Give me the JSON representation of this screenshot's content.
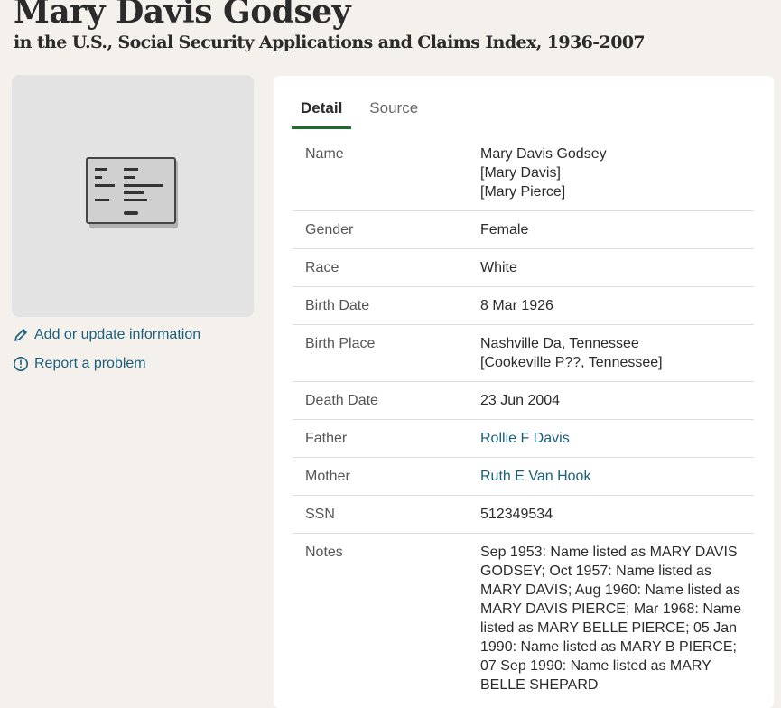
{
  "header": {
    "title": "Mary Davis Godsey",
    "subtitle": "in the U.S., Social Security Applications and Claims Index, 1936-2007"
  },
  "sidebar": {
    "image_icon": "document-card-icon",
    "add_update_label": "Add or update information",
    "add_update_icon": "pencil-icon",
    "report_label": "Report a problem",
    "report_icon": "alert-circle-icon"
  },
  "tabs": [
    {
      "label": "Detail",
      "active": true
    },
    {
      "label": "Source",
      "active": false
    }
  ],
  "colors": {
    "accent": "#1f6b2c",
    "link": "#1a5f7a",
    "background": "#f4f1ed"
  },
  "details": {
    "name": {
      "label": "Name",
      "lines": [
        "Mary Davis Godsey",
        "[Mary Davis]",
        "[Mary Pierce]"
      ]
    },
    "gender": {
      "label": "Gender",
      "value": "Female"
    },
    "race": {
      "label": "Race",
      "value": "White"
    },
    "birth_date": {
      "label": "Birth Date",
      "value": "8 Mar 1926"
    },
    "birth_place": {
      "label": "Birth Place",
      "lines": [
        "Nashville Da, Tennessee",
        "[Cookeville P??, Tennessee]"
      ]
    },
    "death_date": {
      "label": "Death Date",
      "value": "23 Jun 2004"
    },
    "father": {
      "label": "Father",
      "value": "Rollie F Davis"
    },
    "mother": {
      "label": "Mother",
      "value": "Ruth E Van Hook"
    },
    "ssn": {
      "label": "SSN",
      "value": "512349534"
    },
    "notes": {
      "label": "Notes",
      "value": "Sep 1953: Name listed as MARY DAVIS GODSEY; Oct 1957: Name listed as MARY DAVIS; Aug 1960: Name listed as MARY DAVIS PIERCE; Mar 1968: Name listed as MARY BELLE PIERCE; 05 Jan 1990: Name listed as MARY B PIERCE; 07 Sep 1990: Name listed as MARY BELLE SHEPARD"
    }
  }
}
